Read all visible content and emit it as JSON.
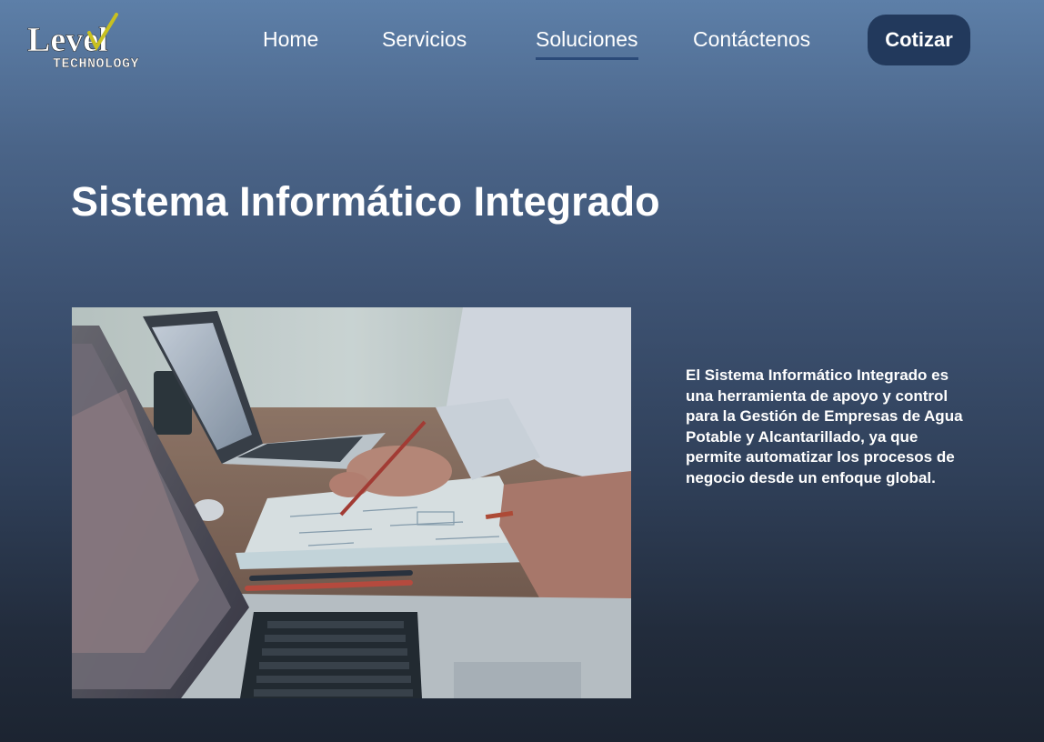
{
  "header": {
    "logo_brand": "Level",
    "logo_sub": "TECHNOLOGY",
    "nav": [
      {
        "label": "Home"
      },
      {
        "label": "Servicios"
      },
      {
        "label": "Soluciones"
      },
      {
        "label": "Contáctenos"
      }
    ],
    "active_nav": "Soluciones",
    "cta_label": "Cotizar"
  },
  "main": {
    "title": "Sistema Informático Integrado",
    "image_icon": "office-laptops-photo",
    "description": "El Sistema Informático Integrado es una herramienta de apoyo y control para la Gestión de Empresas de Agua Potable y Alcantarillado, ya que permite automatizar los procesos de negocio desde un enfoque global."
  },
  "colors": {
    "cta_background": "#22395c",
    "nav_underline": "#2b4a78",
    "logo_check": "#c8c020",
    "text": "#ffffff"
  }
}
